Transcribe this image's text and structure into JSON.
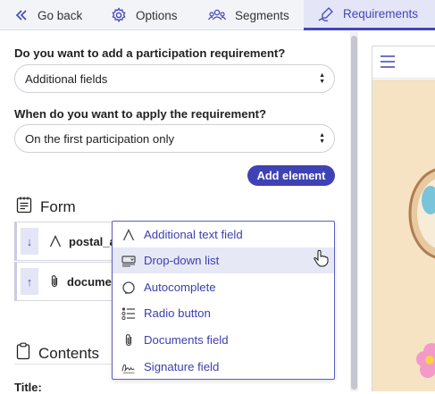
{
  "nav": {
    "back": "Go back",
    "options": "Options",
    "segments": "Segments",
    "requirements": "Requirements"
  },
  "form": {
    "q1_label": "Do you want to add a participation requirement?",
    "q1_value": "Additional fields",
    "q2_label": "When do you want to apply the requirement?",
    "q2_value": "On the first participation only",
    "section_title": "Form",
    "add_button": "Add element",
    "fields": [
      {
        "name": "postal_a",
        "icon": "text-icon",
        "move": "↓"
      },
      {
        "name": "documer",
        "icon": "paperclip-icon",
        "move": "↑"
      }
    ],
    "contents_title": "Contents",
    "title_cut": "Title:"
  },
  "menu": {
    "items": [
      {
        "label": "Additional text field",
        "icon": "text-icon"
      },
      {
        "label": "Drop-down list",
        "icon": "dropdown-icon"
      },
      {
        "label": "Autocomplete",
        "icon": "autocomplete-icon"
      },
      {
        "label": "Radio button",
        "icon": "radio-list-icon"
      },
      {
        "label": "Documents field",
        "icon": "paperclip-icon"
      },
      {
        "label": "Signature field",
        "icon": "signature-icon"
      }
    ],
    "hovered_index": 1
  },
  "colors": {
    "accent": "#3f42b4",
    "menu_text": "#3c3fae",
    "active_tab_bg": "#e4e5f7",
    "preview_bg": "#f6e3c4"
  }
}
